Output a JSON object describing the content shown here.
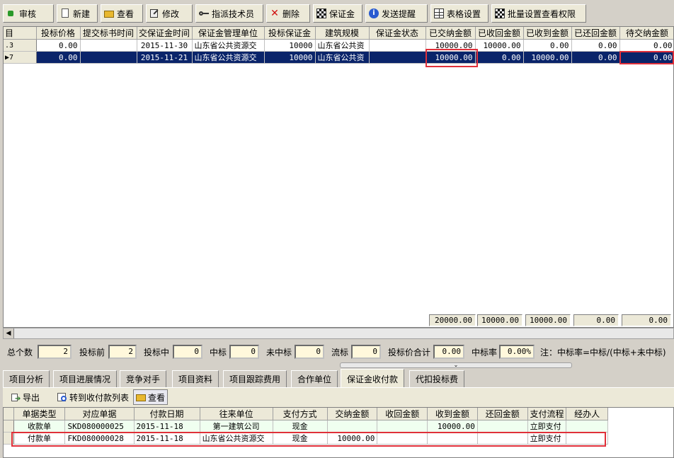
{
  "toolbar": {
    "audit": "审核",
    "new": "新建",
    "view": "查看",
    "edit": "修改",
    "assign": "指派技术员",
    "delete": "删除",
    "deposit": "保证金",
    "remind": "发送提醒",
    "table_settings": "表格设置",
    "batch_perm": "批量设置查看权限"
  },
  "main_grid": {
    "columns": [
      "目",
      "投标价格",
      "提交标书时间",
      "交保证金时间",
      "保证金管理单位",
      "投标保证金",
      "建筑规模",
      "保证金状态",
      "已交纳金额",
      "已收回金额",
      "已收到金额",
      "已还回金额",
      "待交纳金额"
    ],
    "rows": [
      {
        "marker": "",
        "id": ".3",
        "price": "0.00",
        "submit": "",
        "deposit_time": "2015-11-30",
        "unit": "山东省公共资源交",
        "bond": "10000",
        "scale": "山东省公共资",
        "status": "",
        "paid": "10000.00",
        "recovered": "10000.00",
        "received": "0.00",
        "returned": "0.00",
        "pending": "0.00"
      },
      {
        "marker": "▶",
        "id": "7",
        "price": "0.00",
        "submit": "",
        "deposit_time": "2015-11-21",
        "unit": "山东省公共资源交",
        "bond": "10000",
        "scale": "山东省公共资",
        "status": "",
        "paid": "10000.00",
        "recovered": "0.00",
        "received": "10000.00",
        "returned": "0.00",
        "pending": "0.00"
      }
    ],
    "totals": {
      "paid": "20000.00",
      "recovered": "10000.00",
      "received": "10000.00",
      "returned": "0.00",
      "pending": "0.00"
    }
  },
  "stats": {
    "total_label": "总个数",
    "total": "2",
    "before_label": "投标前",
    "before": "2",
    "during_label": "投标中",
    "during": "0",
    "won_label": "中标",
    "won": "0",
    "lost_label": "未中标",
    "lost": "0",
    "failed_label": "流标",
    "failed": "0",
    "price_sum_label": "投标价合计",
    "price_sum": "0.00",
    "rate_label": "中标率",
    "rate": "0.00%",
    "note": "注：中标率=中标/(中标+未中标)"
  },
  "tabs": [
    "项目分析",
    "项目进展情况",
    "竞争对手",
    "项目资料",
    "项目跟踪费用",
    "合作单位",
    "保证金收付款",
    "代扣投标费"
  ],
  "active_tab": "保证金收付款",
  "sub_toolbar": {
    "export": "导出",
    "to_list": "转到收付款列表",
    "view": "查看"
  },
  "sub_grid": {
    "columns": [
      "单据类型",
      "对应单据",
      "付款日期",
      "往来单位",
      "支付方式",
      "交纳金额",
      "收回金额",
      "收到金额",
      "还回金额",
      "支付流程",
      "经办人"
    ],
    "rows": [
      {
        "type": "收款单",
        "doc": "SKD080000025",
        "date": "2015-11-18",
        "partner": "第一建筑公司",
        "method": "现金",
        "paid": "",
        "recovered": "",
        "received": "10000.00",
        "returned": "",
        "flow": "立即支付",
        "handler": ""
      },
      {
        "type": "付款单",
        "doc": "FKD080000028",
        "date": "2015-11-18",
        "partner": "山东省公共资源交",
        "method": "现金",
        "paid": "10000.00",
        "recovered": "",
        "received": "",
        "returned": "",
        "flow": "立即支付",
        "handler": ""
      }
    ]
  }
}
